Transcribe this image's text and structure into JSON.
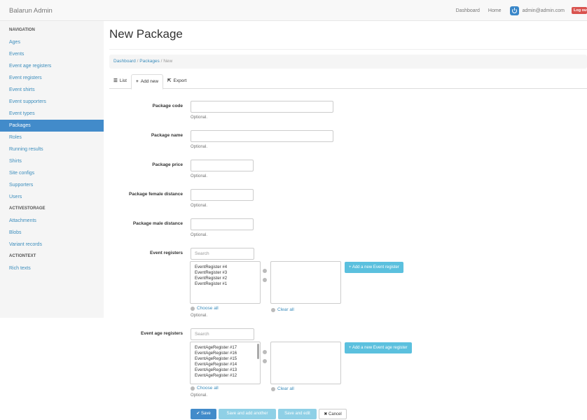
{
  "topbar": {
    "brand": "Balarun Admin",
    "links": [
      "Dashboard",
      "Home"
    ],
    "user": "admin@admin.com",
    "logout": "Log out"
  },
  "sidebar": {
    "sections": [
      {
        "heading": "NAVIGATION",
        "items": [
          "Ages",
          "Events",
          "Event age registers",
          "Event registers",
          "Event shirts",
          "Event supporters",
          "Event types",
          "Packages",
          "Roles",
          "Running results",
          "Shirts",
          "Site configs",
          "Supporters",
          "Users"
        ]
      },
      {
        "heading": "ACTIVESTORAGE",
        "items": [
          "Attachments",
          "Blobs",
          "Variant records"
        ]
      },
      {
        "heading": "ACTIONTEXT",
        "items": [
          "Rich texts"
        ]
      }
    ],
    "active": "Packages"
  },
  "page": {
    "title": "New Package"
  },
  "breadcrumb": {
    "items": [
      "Dashboard",
      "Packages",
      "New"
    ]
  },
  "tabs": [
    {
      "icon": "list-icon",
      "label": "List"
    },
    {
      "icon": "plus-icon",
      "label": "Add new"
    },
    {
      "icon": "export-icon",
      "label": "Export"
    }
  ],
  "form": {
    "optional": "Optional.",
    "fields": [
      {
        "label": "Package code",
        "value": ""
      },
      {
        "label": "Package name",
        "value": ""
      },
      {
        "label": "Package price",
        "value": ""
      },
      {
        "label": "Package female distance",
        "value": ""
      },
      {
        "label": "Package male distance",
        "value": ""
      }
    ],
    "event_registers": {
      "label": "Event registers",
      "search_placeholder": "Search",
      "options": [
        "EventRegister #4",
        "EventRegister #3",
        "EventRegister #2",
        "EventRegister #1"
      ],
      "add_button": "+ Add a new Event register",
      "choose_all": "Choose all",
      "clear_all": "Clear all"
    },
    "event_age_registers": {
      "label": "Event age registers",
      "search_placeholder": "Search",
      "options": [
        "EventAgeRegister #17",
        "EventAgeRegister #16",
        "EventAgeRegister #15",
        "EventAgeRegister #14",
        "EventAgeRegister #13",
        "EventAgeRegister #12"
      ],
      "add_button": "+ Add a new Event age register",
      "choose_all": "Choose all",
      "clear_all": "Clear all"
    }
  },
  "actions": {
    "save": "✔ Save",
    "save_add_another": "Save and add another",
    "save_edit": "Save and edit",
    "cancel": "✖ Cancel"
  },
  "colors": {
    "primary": "#428bca",
    "info": "#5bc0de",
    "danger": "#d9534f"
  }
}
